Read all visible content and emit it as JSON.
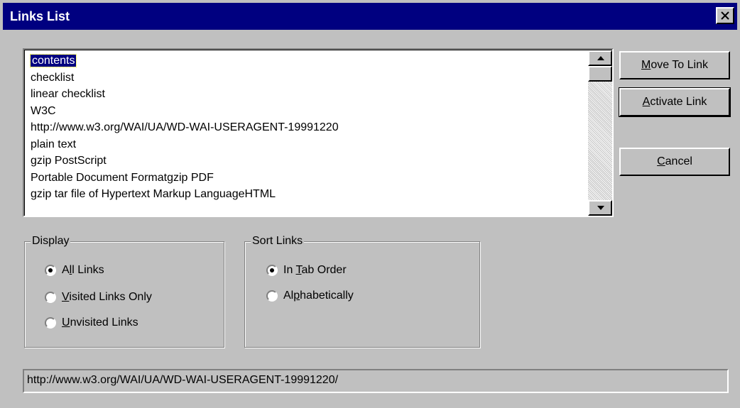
{
  "window": {
    "title": "Links List"
  },
  "links": {
    "items": [
      "contents",
      "checklist",
      "linear checklist",
      "W3C",
      "http://www.w3.org/WAI/UA/WD-WAI-USERAGENT-19991220",
      "plain text",
      "gzip PostScript",
      "Portable Document Formatgzip PDF",
      "gzip tar file of Hypertext Markup LanguageHTML"
    ],
    "selected_index": 0
  },
  "buttons": {
    "move_to_link": {
      "mnemonic": "M",
      "rest": "ove To Link"
    },
    "activate_link": {
      "mnemonic": "A",
      "rest": "ctivate Link"
    },
    "cancel": {
      "mnemonic": "C",
      "rest": "ancel"
    }
  },
  "display_group": {
    "legend": "Display",
    "options": [
      {
        "pre": "A",
        "mnemonic": "l",
        "post": "l Links",
        "checked": true
      },
      {
        "pre": "",
        "mnemonic": "V",
        "post": "isited Links Only",
        "checked": false
      },
      {
        "pre": "",
        "mnemonic": "U",
        "post": "nvisited Links",
        "checked": false
      }
    ]
  },
  "sort_group": {
    "legend": "Sort Links",
    "options": [
      {
        "pre": "In ",
        "mnemonic": "T",
        "post": "ab Order",
        "checked": true
      },
      {
        "pre": "Al",
        "mnemonic": "p",
        "post": "habetically",
        "checked": false
      }
    ]
  },
  "status": {
    "url": "http://www.w3.org/WAI/UA/WD-WAI-USERAGENT-19991220/"
  },
  "colors": {
    "titlebar": "#000080",
    "face": "#c0c0c0",
    "selection": "#000080"
  },
  "icons": {
    "close": "close-icon",
    "scroll_up": "scroll-up-icon",
    "scroll_down": "scroll-down-icon"
  }
}
